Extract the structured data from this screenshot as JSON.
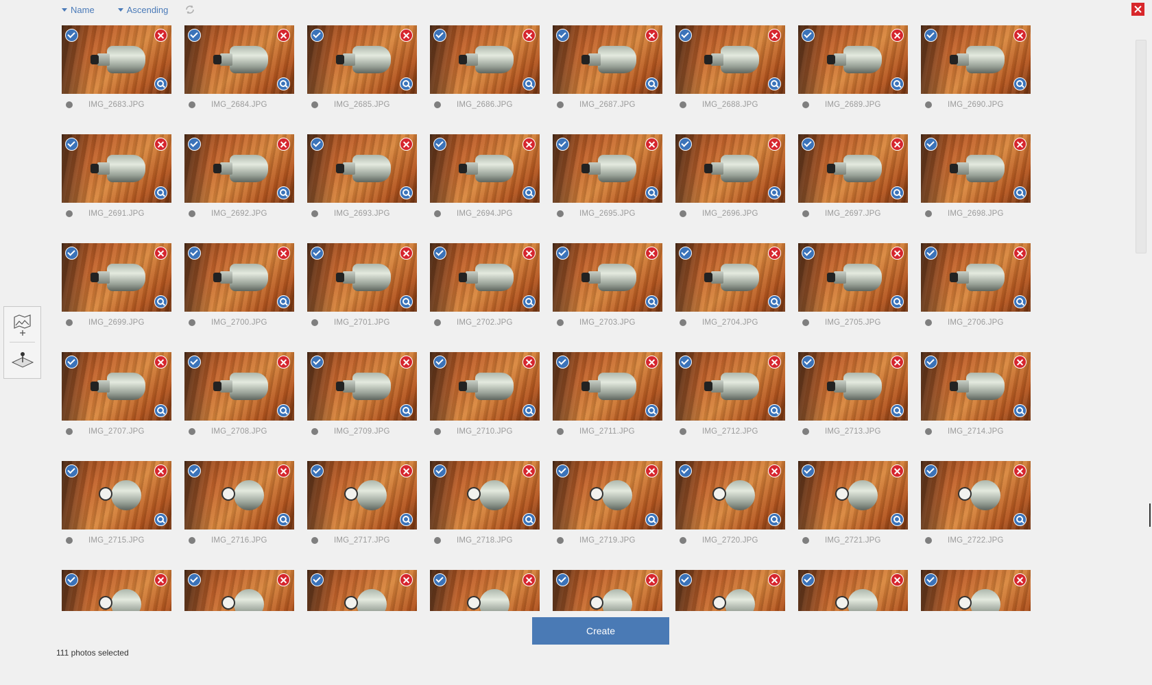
{
  "toolbar": {
    "sort_field": "Name",
    "sort_order": "Ascending",
    "refresh_icon": "refresh-icon",
    "close_icon": "close-icon"
  },
  "side_tools": [
    {
      "name": "add-photos",
      "icon": "image-add-icon"
    },
    {
      "name": "place-on-map",
      "icon": "map-pin-icon"
    }
  ],
  "photos": [
    "IMG_2683.JPG",
    "IMG_2684.JPG",
    "IMG_2685.JPG",
    "IMG_2686.JPG",
    "IMG_2687.JPG",
    "IMG_2688.JPG",
    "IMG_2689.JPG",
    "IMG_2690.JPG",
    "IMG_2691.JPG",
    "IMG_2692.JPG",
    "IMG_2693.JPG",
    "IMG_2694.JPG",
    "IMG_2695.JPG",
    "IMG_2696.JPG",
    "IMG_2697.JPG",
    "IMG_2698.JPG",
    "IMG_2699.JPG",
    "IMG_2700.JPG",
    "IMG_2701.JPG",
    "IMG_2702.JPG",
    "IMG_2703.JPG",
    "IMG_2704.JPG",
    "IMG_2705.JPG",
    "IMG_2706.JPG",
    "IMG_2707.JPG",
    "IMG_2708.JPG",
    "IMG_2709.JPG",
    "IMG_2710.JPG",
    "IMG_2711.JPG",
    "IMG_2712.JPG",
    "IMG_2713.JPG",
    "IMG_2714.JPG",
    "IMG_2715.JPG",
    "IMG_2716.JPG",
    "IMG_2717.JPG",
    "IMG_2718.JPG",
    "IMG_2719.JPG",
    "IMG_2720.JPG",
    "IMG_2721.JPG",
    "IMG_2722.JPG",
    "",
    "",
    "",
    "",
    "",
    "",
    "",
    ""
  ],
  "thumb_icons": {
    "select": "check-icon",
    "remove": "remove-icon",
    "zoom": "zoom-icon"
  },
  "colors": {
    "accent": "#4a7ab5",
    "danger": "#d6262e",
    "background": "#f0f0f0"
  },
  "footer": {
    "create_label": "Create",
    "status_text": "111 photos selected"
  }
}
